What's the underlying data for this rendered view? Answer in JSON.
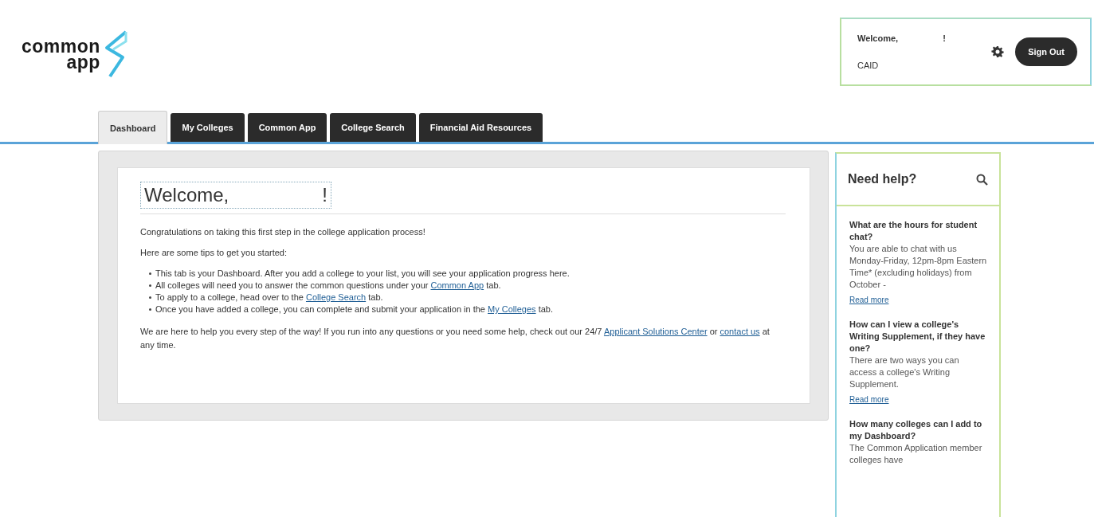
{
  "logo": {
    "line_1": "common",
    "line_2": "app"
  },
  "account": {
    "greeting": "Welcome,",
    "greeting_end": "!",
    "caid_label": "CAID",
    "sign_out": "Sign Out"
  },
  "tabs": [
    {
      "label": "Dashboard",
      "selected": true
    },
    {
      "label": "My Colleges",
      "selected": false
    },
    {
      "label": "Common App",
      "selected": false
    },
    {
      "label": "College Search",
      "selected": false
    },
    {
      "label": "Financial Aid Resources",
      "selected": false
    }
  ],
  "dashboard": {
    "heading": "Welcome,",
    "heading_end": "!",
    "intro": "Congratulations on taking this first step in the college application process!",
    "tips_intro": "Here are some tips to get you started:",
    "tips": [
      [
        {
          "kind": "text",
          "text": "This tab is your Dashboard. After you add a college to your list, you will see your application progress here."
        }
      ],
      [
        {
          "kind": "text",
          "text": "All colleges will need you to answer the common questions under your"
        },
        {
          "kind": "link",
          "text": "Common App"
        },
        {
          "kind": "text",
          "text": "tab."
        }
      ],
      [
        {
          "kind": "text",
          "text": "To apply to a college, head over to the"
        },
        {
          "kind": "link",
          "text": "College Search"
        },
        {
          "kind": "text",
          "text": "tab."
        }
      ],
      [
        {
          "kind": "text",
          "text": "Once you have added a college, you can complete and submit your application in the"
        },
        {
          "kind": "link",
          "text": "My Colleges"
        },
        {
          "kind": "text",
          "text": "tab."
        }
      ]
    ],
    "closing": [
      {
        "kind": "text",
        "text": "We are here to help you every step of the way! If you run into any questions or you need some help, check out our 24/7"
      },
      {
        "kind": "link",
        "text": "Applicant Solutions Center"
      },
      {
        "kind": "text",
        "text": "or"
      },
      {
        "kind": "link",
        "text": "contact us"
      },
      {
        "kind": "text",
        "text": "at any time."
      }
    ]
  },
  "help": {
    "title": "Need help?",
    "articles": [
      {
        "question": "What are the hours for student chat?",
        "answer": "You are able to chat with us Monday-Friday, 12pm-8pm Eastern Time* (excluding holidays) from October -",
        "link": "Read more"
      },
      {
        "question": "How can I view a college's Writing Supplement, if they have one?",
        "answer": "There are two ways you can access a college's Writing Supplement.",
        "link": "Read more"
      },
      {
        "question": "How many colleges can I add to my Dashboard?",
        "answer": "The Common Application member colleges have"
      }
    ]
  }
}
